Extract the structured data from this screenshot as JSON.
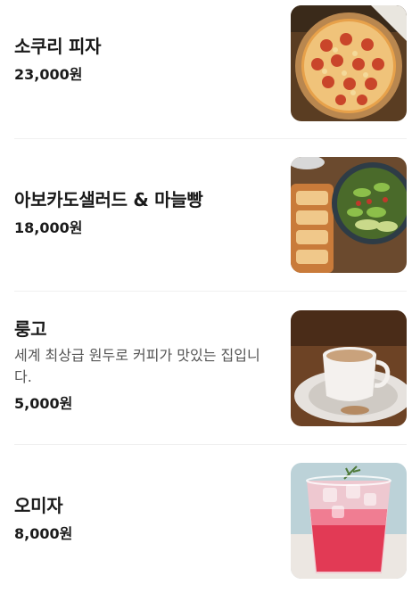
{
  "menu": {
    "items": [
      {
        "name": "소쿠리 피자",
        "description": "",
        "price": "23,000원",
        "image": "pizza-image"
      },
      {
        "name": "아보카도샐러드 & 마늘빵",
        "description": "",
        "price": "18,000원",
        "image": "avocado-salad-image"
      },
      {
        "name": "룽고",
        "description": "세계 최상급 원두로 커피가 맛있는 집입니다.",
        "price": "5,000원",
        "image": "coffee-cup-image"
      },
      {
        "name": "오미자",
        "description": "",
        "price": "8,000원",
        "image": "omija-drink-image"
      }
    ]
  },
  "colors": {
    "text": "#1a1a1a",
    "description": "#555555",
    "divider": "#f0f0f0"
  }
}
